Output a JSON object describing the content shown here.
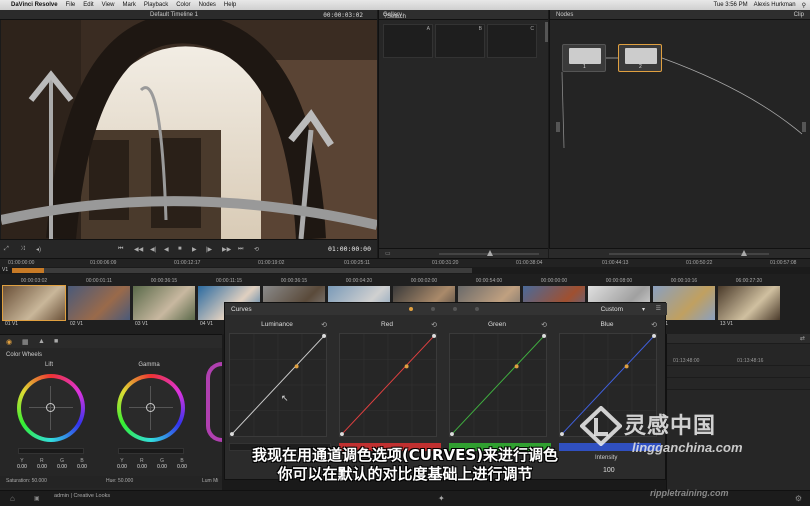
{
  "menubar": {
    "app_name": "DaVinci Resolve",
    "items": [
      "File",
      "Edit",
      "View",
      "Mark",
      "Playback",
      "Color",
      "Nodes",
      "Help"
    ],
    "clock": "Tue 3:56 PM",
    "user": "Alexis Hurkman"
  },
  "viewer": {
    "timeline_name": "Default Timeline 1",
    "timecode_top": "00:00:03:02",
    "timecode_bottom": "01:00:00:00"
  },
  "gallery": {
    "title": "Gallery",
    "search_placeholder": "Search",
    "stills": [
      "A",
      "B",
      "C"
    ]
  },
  "nodes": {
    "title": "Nodes",
    "mode": "Clip",
    "node_labels": [
      "1",
      "2"
    ]
  },
  "ruler": {
    "ticks": [
      "01:00:00:00",
      "01:00:06:09",
      "01:00:12:17",
      "01:00:19:02",
      "01:00:25:11",
      "01:00:31:20",
      "01:00:38:04",
      "01:00:44:13",
      "01:00:50:22",
      "01:00:57:08"
    ]
  },
  "track": {
    "label": "V1"
  },
  "clips": [
    {
      "tc": "00:00:03:02",
      "id": "01 V1"
    },
    {
      "tc": "00:00:01:11",
      "id": "02 V1"
    },
    {
      "tc": "00:00:36:15",
      "id": "03 V1"
    },
    {
      "tc": "00:00:11:15",
      "id": "04 V1"
    },
    {
      "tc": "00:00:36:15",
      "id": ""
    },
    {
      "tc": "00:00:04:20",
      "id": ""
    },
    {
      "tc": "00:00:02:00",
      "id": ""
    },
    {
      "tc": "00:00:54:00",
      "id": ""
    },
    {
      "tc": "00:00:00:00",
      "id": ""
    },
    {
      "tc": "00:00:08:00",
      "id": ""
    },
    {
      "tc": "00:00:10:16",
      "id": "12 V1"
    },
    {
      "tc": "06:00:27:20",
      "id": "13 V1"
    }
  ],
  "color_wheels": {
    "title": "Color Wheels",
    "wheels": [
      {
        "name": "Lift",
        "values": [
          "0.00",
          "0.00",
          "0.00",
          "0.00"
        ]
      },
      {
        "name": "Gamma",
        "values": [
          "0.00",
          "0.00",
          "0.00",
          "0.00"
        ]
      }
    ],
    "channel_labels": [
      "Y",
      "R",
      "G",
      "B"
    ],
    "saturation_label": "Saturation: 50.000",
    "hue_label": "Hue: 50.000",
    "lum_label": "Lum Mi"
  },
  "curves": {
    "title": "Curves",
    "preset": "Custom",
    "channels": [
      "Luminance",
      "Red",
      "Green",
      "Blue"
    ],
    "intensity_label": "Intensity",
    "intensity_value": "100"
  },
  "right_panel": {
    "tc1": "01:13:48:00",
    "tc2": "01:13:48:16"
  },
  "status": {
    "user": "admin | Creative Looks"
  },
  "subtitle": {
    "line1": "我现在用通道调色选项(CURVES)来进行调色",
    "line2": "你可以在默认的对比度基础上进行调节"
  },
  "watermark": {
    "cn": "灵感中国",
    "url": "lingganchina.com",
    "ripple": "rippletraining.com"
  },
  "colors": {
    "accent": "#e0a040",
    "luminance_curve": "#cccccc",
    "red_curve": "#e04040",
    "green_curve": "#40b040",
    "blue_curve": "#4060e0"
  }
}
